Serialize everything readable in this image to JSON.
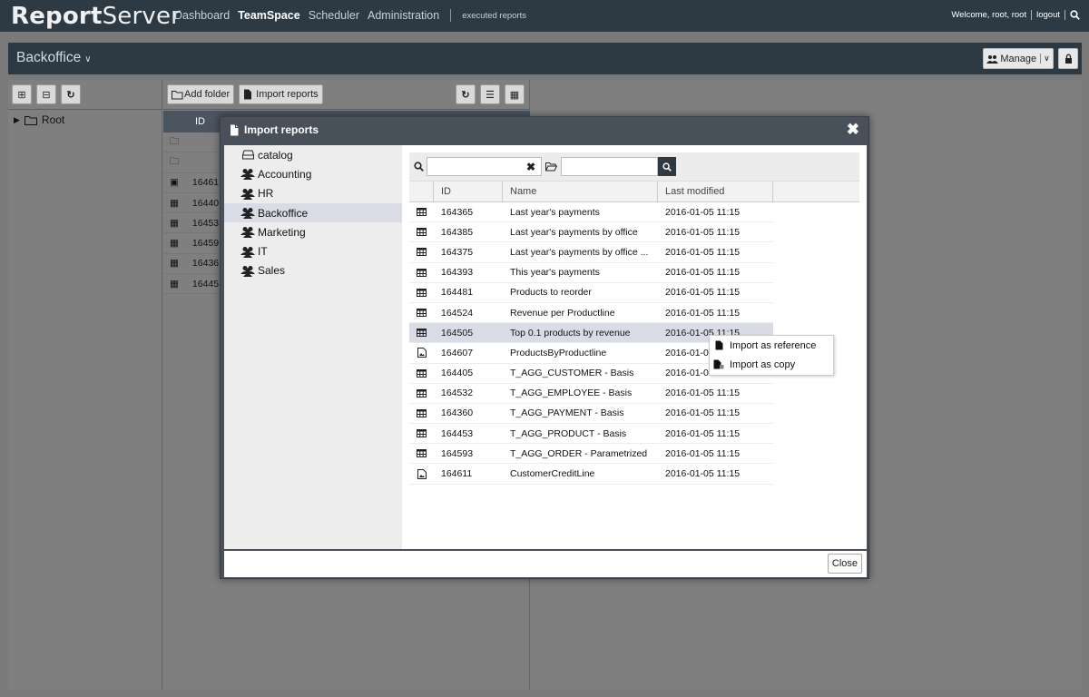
{
  "app": {
    "logo_bold": "Report",
    "logo_rest": "Server"
  },
  "topnav": {
    "items": [
      "Dashboard",
      "TeamSpace",
      "Scheduler",
      "Administration"
    ],
    "executed_reports": "executed reports"
  },
  "user": {
    "welcome": "Welcome, root, root",
    "logout": "logout"
  },
  "teamspace": {
    "title": "Backoffice",
    "manage_label": "Manage"
  },
  "tree": {
    "root_label": "Root"
  },
  "toolbar": {
    "add_folder": "Add folder",
    "import_reports": "Import reports"
  },
  "bg_table": {
    "header_id": "ID",
    "rows": [
      "",
      "",
      "16461",
      "16440",
      "16453",
      "16459",
      "16436",
      "16445"
    ]
  },
  "dialog": {
    "title": "Import reports",
    "close_label": "Close",
    "teamspaces": [
      "catalog",
      "Accounting",
      "HR",
      "Backoffice",
      "Marketing",
      "IT",
      "Sales"
    ],
    "selected_teamspace": "Backoffice",
    "columns": [
      "ID",
      "Name",
      "Last modified"
    ],
    "rows": [
      {
        "icon": "table",
        "id": "164365",
        "name": "Last year's payments",
        "modified": "2016-01-05 11:15"
      },
      {
        "icon": "table",
        "id": "164385",
        "name": "Last year's payments by office",
        "modified": "2016-01-05 11:15"
      },
      {
        "icon": "table",
        "id": "164375",
        "name": "Last year's payments by office ...",
        "modified": "2016-01-05 11:15"
      },
      {
        "icon": "table",
        "id": "164393",
        "name": "This year's payments",
        "modified": "2016-01-05 11:15"
      },
      {
        "icon": "table",
        "id": "164481",
        "name": "Products to reorder",
        "modified": "2016-01-05 11:15"
      },
      {
        "icon": "table",
        "id": "164524",
        "name": "Revenue per Productline",
        "modified": "2016-01-05 11:15"
      },
      {
        "icon": "table",
        "id": "164505",
        "name": "Top 0.1 products by revenue",
        "modified": "2016-01-05 11:15"
      },
      {
        "icon": "image",
        "id": "164607",
        "name": "ProductsByProductline",
        "modified": "2016-01-0"
      },
      {
        "icon": "table",
        "id": "164405",
        "name": "T_AGG_CUSTOMER - Basis",
        "modified": "2016-01-05 11:15"
      },
      {
        "icon": "table",
        "id": "164532",
        "name": "T_AGG_EMPLOYEE - Basis",
        "modified": "2016-01-05 11:15"
      },
      {
        "icon": "table",
        "id": "164360",
        "name": "T_AGG_PAYMENT - Basis",
        "modified": "2016-01-05 11:15"
      },
      {
        "icon": "table",
        "id": "164453",
        "name": "T_AGG_PRODUCT - Basis",
        "modified": "2016-01-05 11:15"
      },
      {
        "icon": "table",
        "id": "164593",
        "name": "T_AGG_ORDER - Parametrized",
        "modified": "2016-01-05 11:15"
      },
      {
        "icon": "image",
        "id": "164611",
        "name": "CustomerCreditLine",
        "modified": "2016-01-05 11:15"
      }
    ],
    "highlighted_row_id": "164505"
  },
  "context_menu": {
    "items": [
      "Import as reference",
      "Import as copy"
    ]
  }
}
